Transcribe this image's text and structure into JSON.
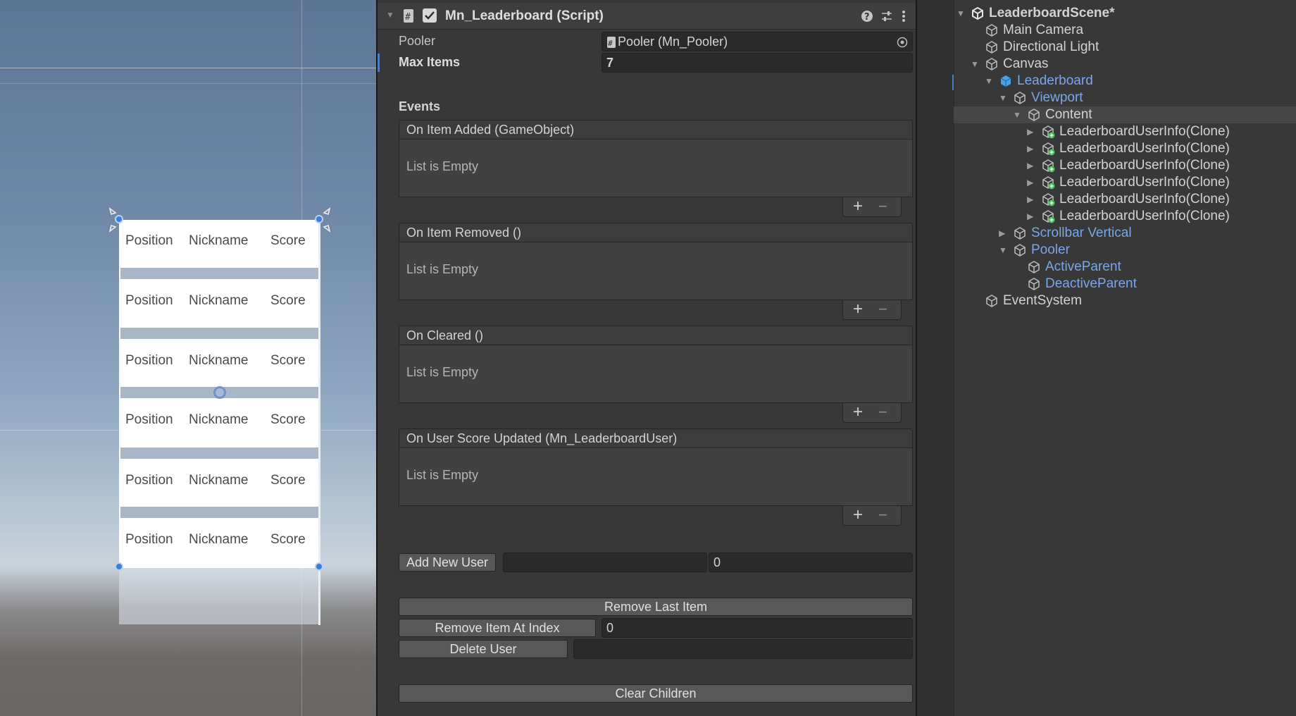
{
  "scene": {
    "rows": [
      {
        "position": "Position",
        "nickname": "Nickname",
        "score": "Score"
      },
      {
        "position": "Position",
        "nickname": "Nickname",
        "score": "Score"
      },
      {
        "position": "Position",
        "nickname": "Nickname",
        "score": "Score"
      },
      {
        "position": "Position",
        "nickname": "Nickname",
        "score": "Score"
      },
      {
        "position": "Position",
        "nickname": "Nickname",
        "score": "Score"
      },
      {
        "position": "Position",
        "nickname": "Nickname",
        "score": "Score"
      }
    ]
  },
  "inspector": {
    "component_title": "Mn_Leaderboard (Script)",
    "enabled": true,
    "pooler_label": "Pooler",
    "pooler_value": "Pooler (Mn_Pooler)",
    "max_items_label": "Max Items",
    "max_items_value": "7",
    "events_label": "Events",
    "events": [
      {
        "title": "On Item Added (GameObject)",
        "empty_text": "List is Empty"
      },
      {
        "title": "On Item Removed ()",
        "empty_text": "List is Empty"
      },
      {
        "title": "On Cleared ()",
        "empty_text": "List is Empty"
      },
      {
        "title": "On User Score Updated (Mn_LeaderboardUser)",
        "empty_text": "List is Empty"
      }
    ],
    "plus": "+",
    "minus": "−",
    "add_new_user_label": "Add New User",
    "add_new_user_name": "",
    "add_new_user_score": "0",
    "remove_last_item_label": "Remove Last Item",
    "remove_item_at_index_label": "Remove Item At Index",
    "remove_index_value": "0",
    "delete_user_label": "Delete User",
    "delete_user_value": "",
    "clear_children_label": "Clear Children"
  },
  "hierarchy": {
    "scene_name": "LeaderboardScene*",
    "items": {
      "main_camera": "Main Camera",
      "directional_light": "Directional Light",
      "canvas": "Canvas",
      "leaderboard": "Leaderboard",
      "viewport": "Viewport",
      "content": "Content",
      "clone_1": "LeaderboardUserInfo(Clone)",
      "clone_2": "LeaderboardUserInfo(Clone)",
      "clone_3": "LeaderboardUserInfo(Clone)",
      "clone_4": "LeaderboardUserInfo(Clone)",
      "clone_5": "LeaderboardUserInfo(Clone)",
      "clone_6": "LeaderboardUserInfo(Clone)",
      "scrollbar_vertical": "Scrollbar Vertical",
      "pooler": "Pooler",
      "active_parent": "ActiveParent",
      "deactive_parent": "DeactiveParent",
      "event_system": "EventSystem"
    }
  },
  "colors": {
    "prefab_blue": "#7aa6e8",
    "selection_handle": "#3f7ed8",
    "inspector_bg": "#383838",
    "prefab_badge_green": "#3ec25a"
  },
  "icons": [
    "script-icon",
    "checkbox-icon",
    "help-icon",
    "preset-icon",
    "kebab-menu-icon",
    "object-picker-icon",
    "gameobject-cube-icon",
    "prefab-cube-icon",
    "foldout-arrow-icon"
  ]
}
